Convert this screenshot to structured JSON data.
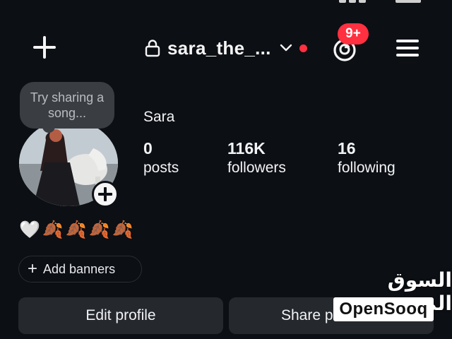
{
  "top_bar": {
    "username": "sara_the_...",
    "notification_badge": "9+",
    "icons": {
      "create": "plus-icon",
      "lock": "lock-icon",
      "dropdown": "chevron-down-icon",
      "threads": "threads-icon",
      "menu": "hamburger-menu-icon"
    },
    "accent_red": "#ff3040"
  },
  "profile": {
    "note_text": "Try sharing a song...",
    "display_name": "Sara",
    "stats": {
      "posts_count": "0",
      "posts_label": "posts",
      "followers_count": "116K",
      "followers_label": "followers",
      "following_count": "16",
      "following_label": "following"
    },
    "bio": "🤍🍂🍂🍂🍂",
    "add_banners_label": "Add banners"
  },
  "actions": {
    "edit_profile": "Edit profile",
    "share_profile": "Share p"
  },
  "watermark": {
    "arabic": "السوق المفتوح",
    "latin": "OpenSooq"
  }
}
